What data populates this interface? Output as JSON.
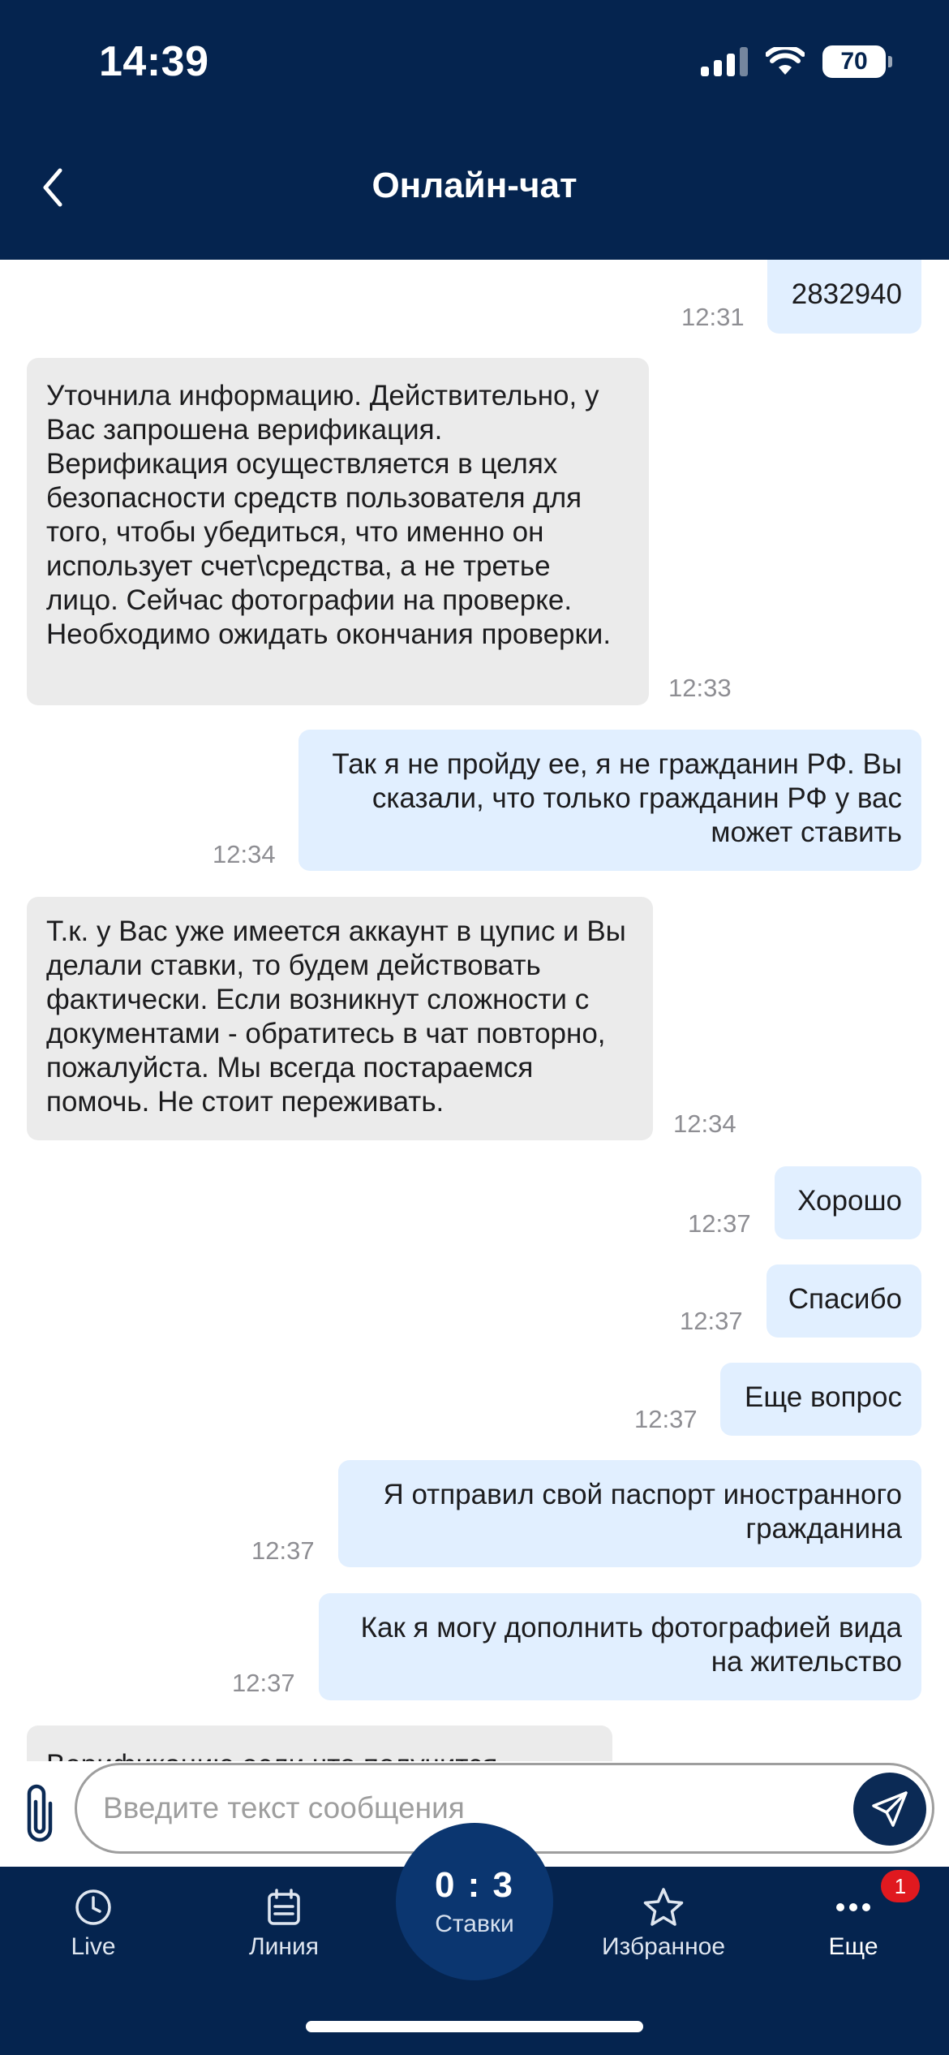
{
  "status_bar": {
    "time": "14:39",
    "battery": "70"
  },
  "header": {
    "title": "Онлайн-чат"
  },
  "messages": [
    {
      "dir": "out",
      "text": "2832940",
      "time": "12:31"
    },
    {
      "dir": "in",
      "text": "Уточнила информацию. Действительно, у Вас запрошена верификация. Верификация осуществляется в целях безопасности средств пользователя для того, чтобы убедиться, что именно он использует счет\\средства, а не третье лицо. Сейчас фотографии на проверке. Необходимо ожидать окончания проверки.",
      "time": "12:33"
    },
    {
      "dir": "out",
      "text": "Так я не пройду ее, я не гражданин РФ. Вы сказали, что только гражданин РФ у вас может ставить",
      "time": "12:34"
    },
    {
      "dir": "in",
      "text": "Т.к. у Вас уже имеется аккаунт в цупис и Вы делали ставки, то будем действовать фактически. Если возникнут сложности с документами - обратитесь в чат повторно, пожалуйста. Мы всегда постараемся помочь. Не стоит переживать.",
      "time": "12:34"
    },
    {
      "dir": "out",
      "text": "Хорошо",
      "time": "12:37"
    },
    {
      "dir": "out",
      "text": "Спасибо",
      "time": "12:37"
    },
    {
      "dir": "out",
      "text": "Еще вопрос",
      "time": "12:37"
    },
    {
      "dir": "out",
      "text": "Я отправил свой паспорт иностранного гражданина",
      "time": "12:37"
    },
    {
      "dir": "out",
      "text": "Как я могу дополнить фотографией вида на жительство",
      "time": "12:37"
    },
    {
      "dir": "in",
      "text": "Верификацию если что получится",
      "time": ""
    }
  ],
  "composer": {
    "placeholder": "Введите текст сообщения"
  },
  "tabbar": {
    "live": "Live",
    "line": "Линия",
    "bets_score": "0 : 3",
    "bets": "Ставки",
    "favorites": "Избранное",
    "more": "Еще",
    "more_badge": "1"
  }
}
